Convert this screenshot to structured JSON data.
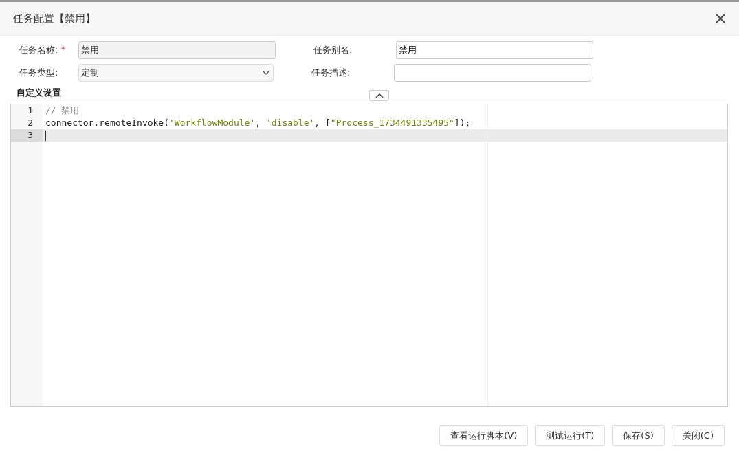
{
  "dialog": {
    "title": "任务配置【禁用】"
  },
  "form": {
    "name": {
      "label": "任务名称:",
      "required_mark": "*",
      "value": "禁用",
      "disabled": true
    },
    "alias": {
      "label": "任务别名:",
      "value": "禁用"
    },
    "type": {
      "label": "任务类型:",
      "value": "定制"
    },
    "description": {
      "label": "任务描述:"
    }
  },
  "section": {
    "title": "自定义设置",
    "expanded": true
  },
  "editor": {
    "lines": [
      {
        "number": "1",
        "active": false,
        "tokens": [
          {
            "kind": "comment",
            "text": "// 禁用"
          }
        ]
      },
      {
        "number": "2",
        "active": false,
        "tokens": [
          {
            "kind": "plain",
            "text": "connector.remoteInvoke("
          },
          {
            "kind": "string",
            "text": "'WorkflowModule'"
          },
          {
            "kind": "plain",
            "text": ", "
          },
          {
            "kind": "string",
            "text": "'disable'"
          },
          {
            "kind": "plain",
            "text": ", ["
          },
          {
            "kind": "string",
            "text": "\"Process_1734491335495\""
          },
          {
            "kind": "plain",
            "text": "]);"
          }
        ]
      },
      {
        "number": "3",
        "active": true
      }
    ]
  },
  "buttons": [
    "查看运行脚本(V)",
    "测试运行(T)",
    "保存(S)",
    "关闭(C)"
  ]
}
